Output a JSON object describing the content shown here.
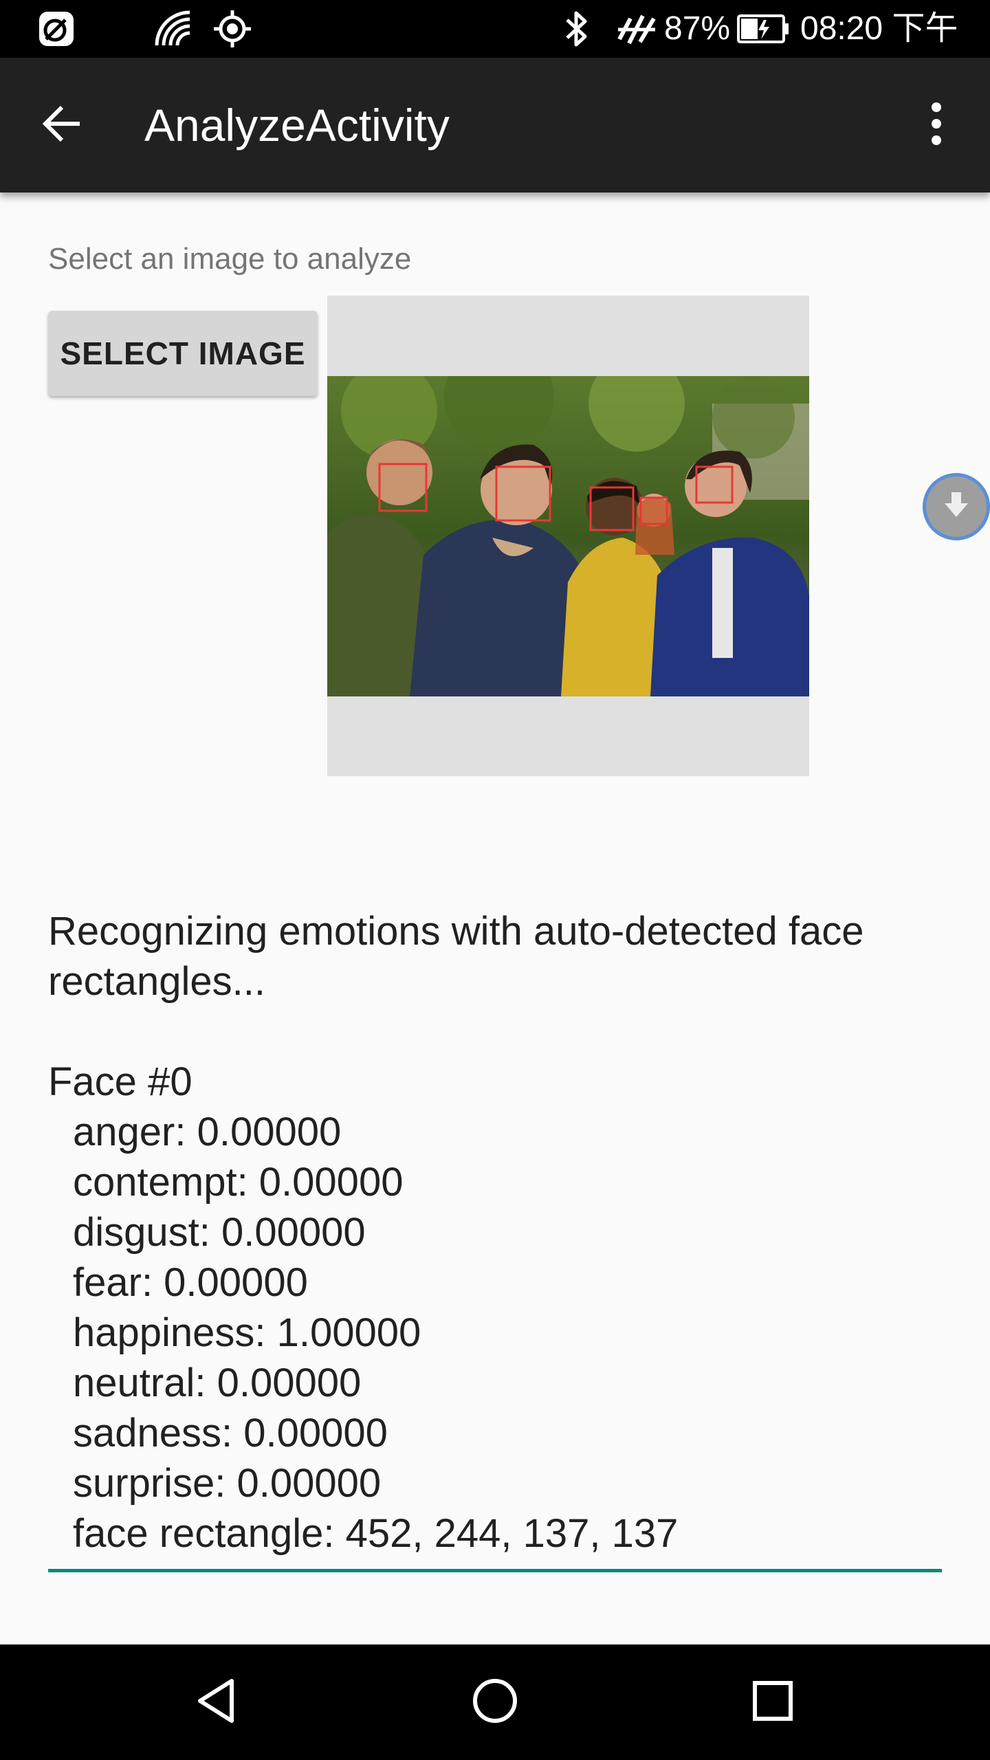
{
  "status_bar": {
    "battery_text": "87%",
    "time": "08:20 下午"
  },
  "app_bar": {
    "title": "AnalyzeActivity"
  },
  "content": {
    "hint": "Select an image to analyze",
    "select_button": "SELECT IMAGE",
    "status_line_1": "Recognizing emotions with auto-detected face",
    "status_line_2": "rectangles...",
    "face_header": "Face #0",
    "emotions": [
      "anger: 0.00000",
      "contempt: 0.00000",
      "disgust: 0.00000",
      "fear: 0.00000",
      "happiness: 1.00000",
      "neutral: 0.00000",
      "sadness: 0.00000",
      "surprise: 0.00000",
      "face rectangle: 452, 244, 137, 137"
    ]
  },
  "colors": {
    "accent": "#00897b",
    "face_box": "#e53935",
    "app_bar": "#212121"
  },
  "icons": {
    "back": "arrow-left-icon",
    "overflow": "more-vert-icon",
    "fab": "download-icon"
  }
}
